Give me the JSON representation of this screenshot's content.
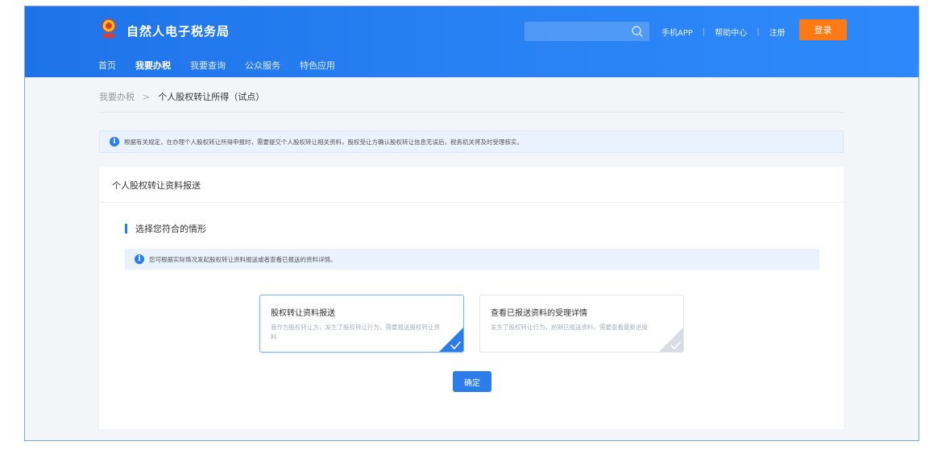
{
  "header": {
    "site_title": "自然人电子税务局",
    "search_placeholder": "",
    "links": [
      "手机APP",
      "帮助中心",
      "注册"
    ],
    "login_label": "登录",
    "brand_color": "#2b7de9",
    "login_color": "#ff7a14"
  },
  "nav": {
    "items": [
      "首页",
      "我要办税",
      "我要查询",
      "公众服务",
      "特色应用"
    ],
    "active_index": 1
  },
  "breadcrumb": {
    "parent": "我要办税",
    "current": "个人股权转让所得（试点）"
  },
  "notice_top": "根据有关规定，在办理个人股权转让所得申报时，需要提交个人股权转让相关资料，股权受让方确认股权转让信息无误后，税务机关将及时受理核实。",
  "card": {
    "title": "个人股权转让资料报送",
    "section_title": "选择您符合的情形",
    "notice_inner": "您可根据实际情况发起股权转让资料报送或者查看已报送的资料详情。",
    "options": [
      {
        "title": "股权转让资料报送",
        "desc": "我作为股权转让方，发生了股权转让行为，需要报送股权转让资料",
        "selected": true
      },
      {
        "title": "查看已报送资料的受理详情",
        "desc": "发生了股权转让行为，前期已报送资料，需要查看最新进度",
        "selected": false
      }
    ],
    "confirm_label": "确定"
  }
}
